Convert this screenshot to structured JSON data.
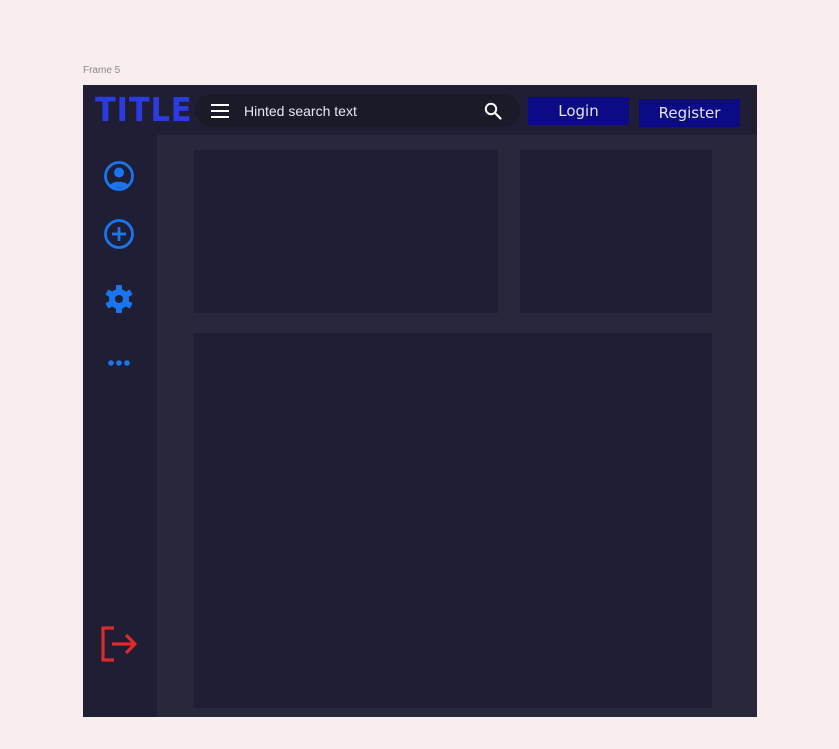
{
  "frame": {
    "label": "Frame 5"
  },
  "header": {
    "title": "TITLE",
    "search": {
      "placeholder": "Hinted search text"
    },
    "login_label": "Login",
    "register_label": "Register"
  },
  "sidebar": {
    "items": [
      {
        "icon": "account-circle-icon"
      },
      {
        "icon": "add-circle-icon"
      },
      {
        "icon": "gear-icon"
      },
      {
        "icon": "more-horizontal-icon"
      },
      {
        "icon": "logout-icon"
      }
    ]
  },
  "colors": {
    "page_background": "#F9EEEE",
    "frame_background": "#28273C",
    "panel_background": "#1F1E34",
    "logo": "#2B3BE0",
    "button": "#0C0B85",
    "icon_accent": "#1976F0",
    "logout_icon": "#E02A2A"
  }
}
